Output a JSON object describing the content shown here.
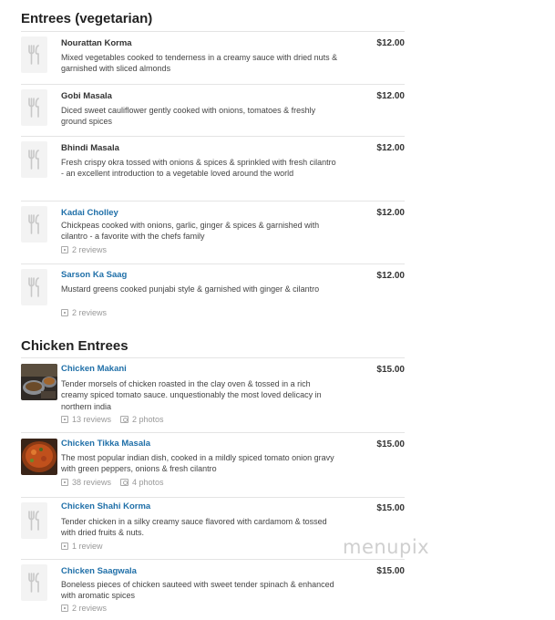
{
  "sections": [
    {
      "title": "Entrees (vegetarian)",
      "items": [
        {
          "name": "Nourattan Korma",
          "price": "$12.00",
          "desc": "Mixed vegetables cooked to tenderness in a creamy sauce with dried nuts & garnished with sliced almonds"
        },
        {
          "name": "Gobi Masala",
          "price": "$12.00",
          "desc": "Diced sweet cauliflower gently cooked with onions, tomatoes & freshly ground spices"
        },
        {
          "name": "Bhindi Masala",
          "price": "$12.00",
          "desc": "Fresh crispy okra tossed with onions & spices & sprinkled with fresh cilantro - an excellent introduction to a vegetable loved around the world"
        },
        {
          "name": "Kadai Cholley",
          "price": "$12.00",
          "desc": "Chickpeas cooked with onions, garlic, ginger & spices & garnished with cilantro - a favorite with the chefs family",
          "reviews": "2 reviews"
        },
        {
          "name": "Sarson Ka Saag",
          "price": "$12.00",
          "desc": "Mustard greens cooked punjabi style & garnished with ginger & cilantro",
          "reviews": "2 reviews"
        }
      ]
    },
    {
      "title": "Chicken Entrees",
      "items": [
        {
          "name": "Chicken Makani",
          "price": "$15.00",
          "desc": "Tender morsels of chicken roasted in the clay oven & tossed in a rich creamy spiced tomato sauce. unquestionably the most loved delicacy in northern india",
          "reviews": "13 reviews",
          "photos": "2 photos"
        },
        {
          "name": "Chicken Tikka Masala",
          "price": "$15.00",
          "desc": "The most popular indian dish, cooked in a mildly spiced tomato onion gravy with green peppers, onions & fresh cilantro",
          "reviews": "38 reviews",
          "photos": "4 photos"
        },
        {
          "name": "Chicken Shahi Korma",
          "price": "$15.00",
          "desc": "Tender chicken in a silky creamy sauce flavored with cardamom & tossed with dried fruits & nuts.",
          "reviews": "1 review"
        },
        {
          "name": "Chicken Saagwala",
          "price": "$15.00",
          "desc": "Boneless pieces of chicken sauteed with sweet tender spinach & enhanced with aromatic spices",
          "reviews": "2 reviews"
        }
      ]
    }
  ],
  "watermark": "menupix",
  "icons": {
    "placeholder": "fork-knife-icon",
    "reviews": "review-icon",
    "photos": "camera-icon"
  }
}
